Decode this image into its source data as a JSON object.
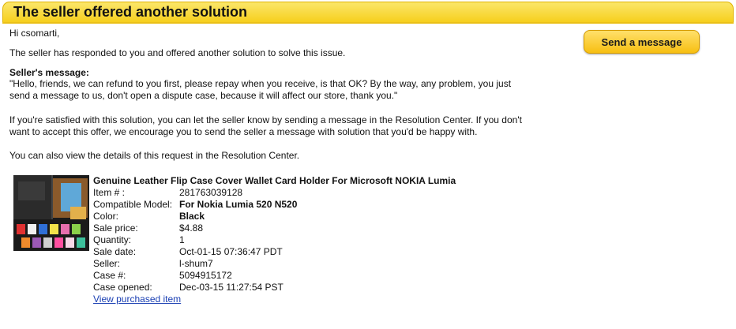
{
  "header": {
    "title": "The seller offered another solution"
  },
  "body": {
    "greeting": "Hi csomarti,",
    "intro": "The seller has responded to you and offered another solution to solve this issue.",
    "seller_message_label": "Seller's message:",
    "seller_message_line1": "\"Hello, friends, we can refund to you first, please repay when you receive, is that OK? By the way, any problem, you just",
    "seller_message_line2": "send a message to us, don't open a dispute case, because it will affect our store, thank you.\"",
    "satisfied_line1": "If you're satisfied with this solution, you can let the seller know by sending a message in the Resolution Center. If you don't",
    "satisfied_line2": "want to accept this offer, we encourage you to send the seller a message with solution that you'd be happy with.",
    "resolution_center_note": "You can also view the details of this request in the Resolution Center."
  },
  "actions": {
    "send_message_label": "Send a message"
  },
  "item": {
    "title": "Genuine Leather Flip Case Cover Wallet Card Holder For Microsoft NOKIA Lumia",
    "item_number_label": "Item # :",
    "item_number": "281763039128",
    "compatible_model_label": "Compatible Model:",
    "compatible_model": "For Nokia Lumia 520 N520",
    "color_label": "Color:",
    "color": "Black",
    "sale_price_label": "Sale price:",
    "sale_price": "$4.88",
    "quantity_label": "Quantity:",
    "quantity": "1",
    "sale_date_label": "Sale date:",
    "sale_date": "Oct-01-15 07:36:47 PDT",
    "seller_label": "Seller:",
    "seller": "l-shum7",
    "case_number_label": "Case #:",
    "case_number": "5094915172",
    "case_opened_label": "Case opened:",
    "case_opened": "Dec-03-15 11:27:54 PST",
    "view_link": "View purchased item"
  },
  "colors": {
    "header_yellow": "#f6cf1d",
    "button_yellow": "#f7bf12",
    "link_blue": "#1a3fb3"
  }
}
